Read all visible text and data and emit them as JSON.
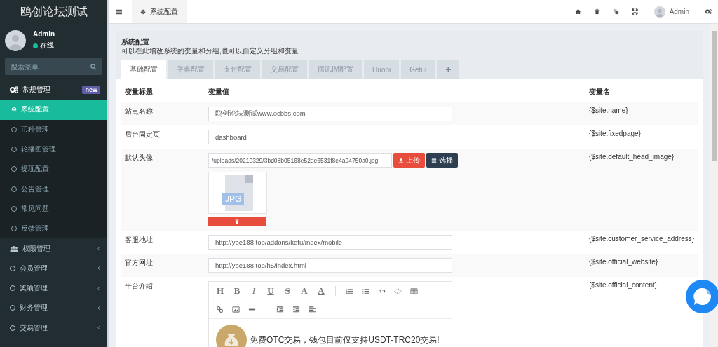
{
  "sidebar": {
    "logo": "鸥创论坛测试",
    "user": {
      "name": "Admin",
      "status": "在线",
      "online": true
    },
    "search": {
      "placeholder": "搜索菜单"
    },
    "items": [
      {
        "label": "常规管理",
        "badge": "new",
        "expanded": true,
        "children": [
          {
            "label": "系统配置",
            "selected": true
          },
          {
            "label": "币种管理",
            "selected": false
          },
          {
            "label": "轮播图管理",
            "selected": false
          },
          {
            "label": "提现配置",
            "selected": false
          },
          {
            "label": "公告管理",
            "selected": false
          },
          {
            "label": "常见问题",
            "selected": false
          },
          {
            "label": "反馈管理",
            "selected": false
          }
        ]
      },
      {
        "label": "权限管理",
        "expanded": false
      },
      {
        "label": "会员管理",
        "expanded": false
      },
      {
        "label": "奖项管理",
        "expanded": false
      },
      {
        "label": "财务管理",
        "expanded": false
      },
      {
        "label": "交易管理",
        "expanded": false
      }
    ]
  },
  "topbar": {
    "tabs": [
      {
        "label": "系统配置",
        "selected": true
      }
    ],
    "user": "Admin"
  },
  "panel": {
    "title": "系统配置",
    "description": "可以在此增改系统的变量和分组,也可以自定义分组和变量",
    "tabs": [
      {
        "label": "基础配置",
        "selected": true
      },
      {
        "label": "字典配置",
        "selected": false
      },
      {
        "label": "支付配置",
        "selected": false
      },
      {
        "label": "交易配置",
        "selected": false
      },
      {
        "label": "腾讯IM配置",
        "selected": false
      },
      {
        "label": "Huobi",
        "selected": false
      },
      {
        "label": "Getui",
        "selected": false
      },
      {
        "label": "+",
        "selected": false
      }
    ],
    "table": {
      "columns": [
        "变量标题",
        "变量值",
        "变量名"
      ],
      "rows": [
        {
          "kind": "text",
          "title": "站点名称",
          "value": "鸥创论坛测试www.ocbbs.com",
          "variable": "{$site.name}"
        },
        {
          "kind": "text",
          "title": "后台固定页",
          "value": "dashboard",
          "variable": "{$site.fixedpage}"
        },
        {
          "kind": "image",
          "title": "默认头像",
          "value": "/uploads/20210329/3bd08b05168e52ee6531f8e4a94750a0.jpg",
          "upload": "上传",
          "choose": "选择",
          "thumbnail": "JPG",
          "variable": "{$site.default_head_image}"
        },
        {
          "kind": "text",
          "title": "客服地址",
          "value": "http://ybe188.top/addons/kefu/index/mobile",
          "variable": "{$site.customer_service_address}"
        },
        {
          "kind": "text",
          "title": "官方网址",
          "value": "http://ybe188.top/h5/index.html",
          "variable": "{$site.official_website}"
        },
        {
          "kind": "editor",
          "title": "平台介绍",
          "variable": "{$site.official_content}",
          "toolbar": [
            [
              {
                "kind": "letter",
                "label": "H"
              },
              {
                "kind": "letter",
                "label": "B"
              },
              {
                "kind": "italic",
                "label": "I"
              },
              {
                "kind": "underlined",
                "label": "U"
              },
              {
                "kind": "struck",
                "label": "S"
              },
              {
                "kind": "letter",
                "label": "A"
              },
              {
                "kind": "underlined",
                "label": "A"
              },
              {
                "kind": "separator"
              },
              {
                "kind": "olist"
              },
              {
                "kind": "ulist"
              },
              {
                "kind": "quote"
              },
              {
                "kind": "code"
              },
              {
                "kind": "table"
              },
              {
                "kind": "separator"
              }
            ],
            [
              {
                "kind": "link"
              },
              {
                "kind": "image"
              },
              {
                "kind": "rule"
              },
              {
                "kind": "separator"
              },
              {
                "kind": "indent"
              },
              {
                "kind": "outdent"
              },
              {
                "kind": "align"
              }
            ]
          ],
          "content": "免费OTC交易，钱包目前仅支持USDT-TRC20交易!"
        }
      ]
    }
  }
}
